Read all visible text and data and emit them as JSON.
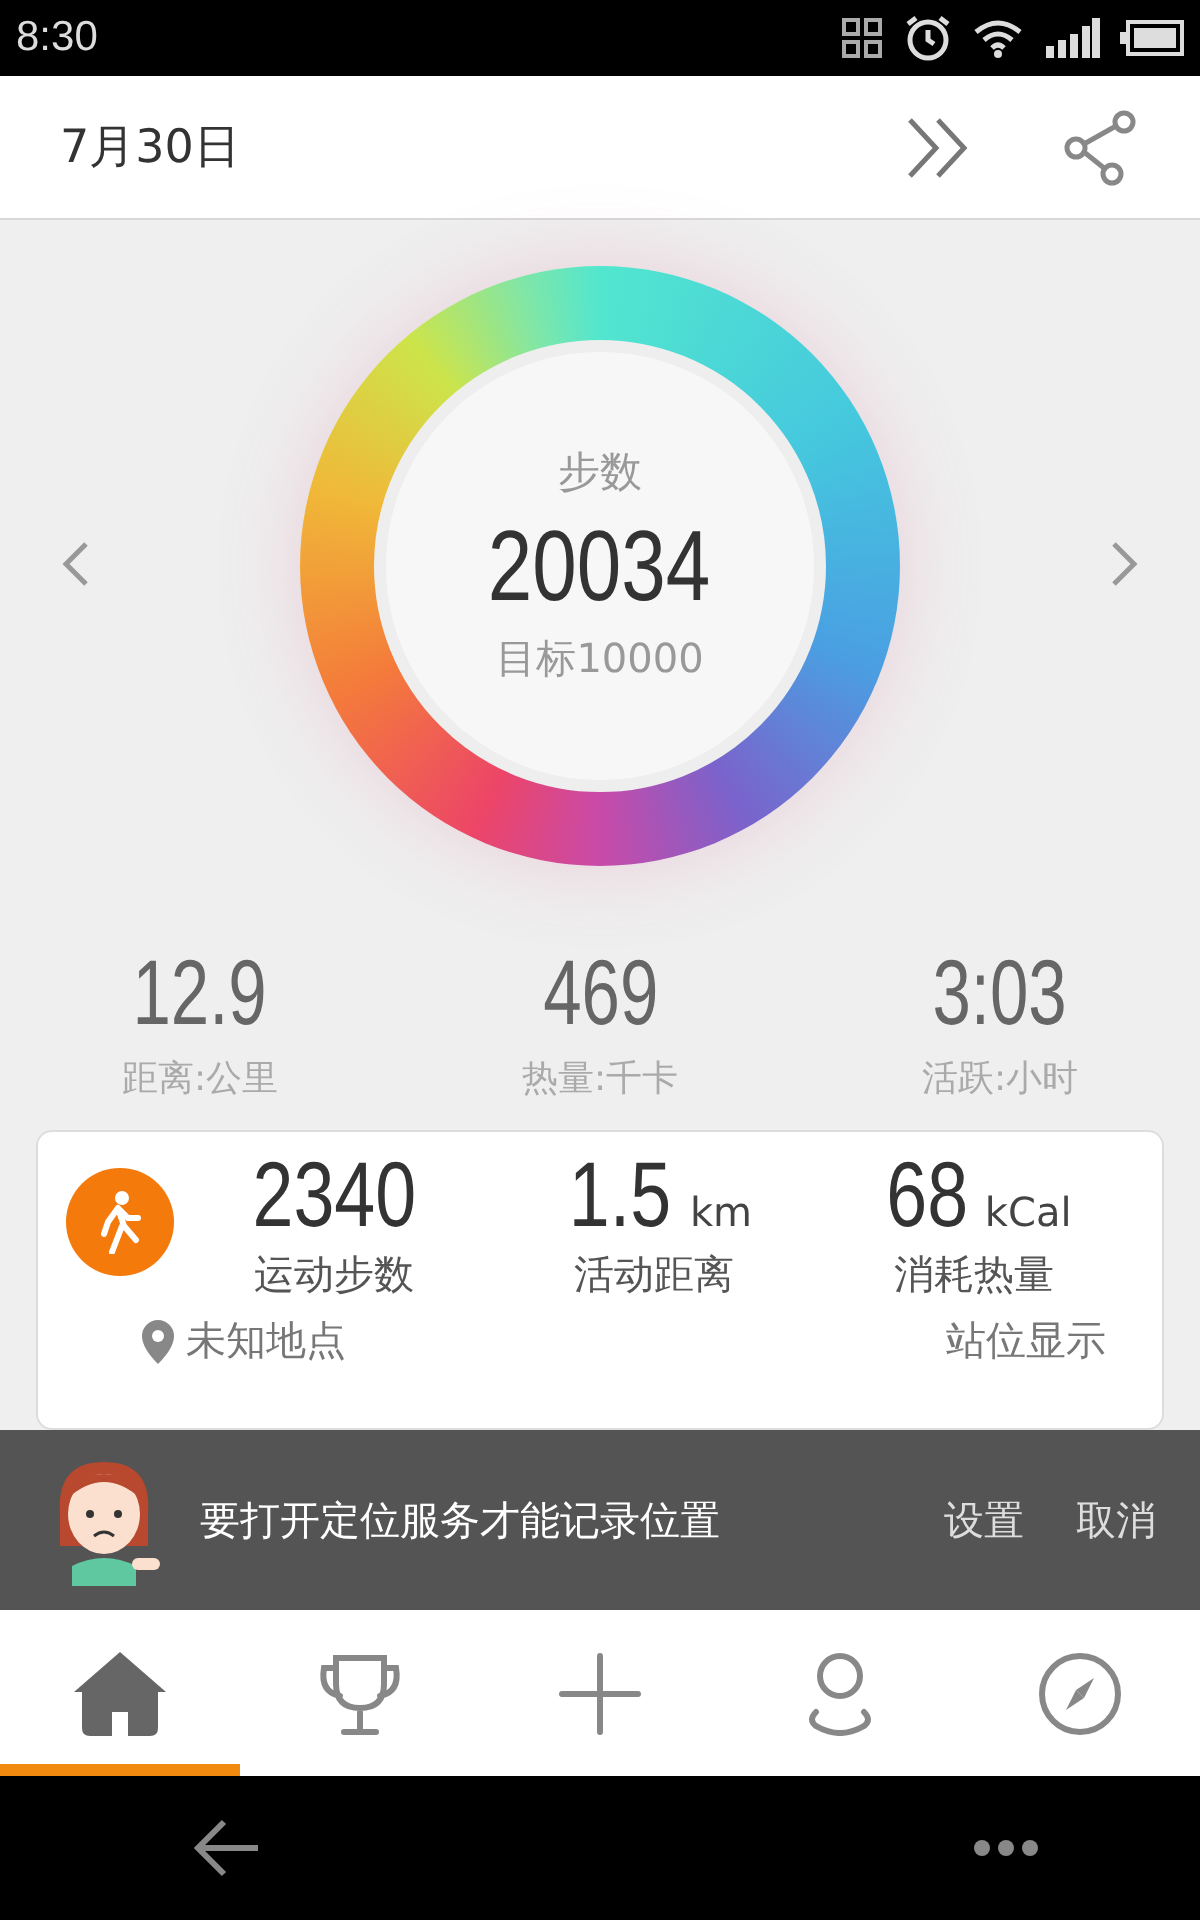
{
  "status_bar": {
    "time": "8:30"
  },
  "header": {
    "date": "7月30日"
  },
  "ring": {
    "label": "步数",
    "value": "20034",
    "goal": "目标10000"
  },
  "summary": [
    {
      "value": "12.9",
      "label": "距离:公里"
    },
    {
      "value": "469",
      "label": "热量:千卡"
    },
    {
      "value": "3:03",
      "label": "活跃:小时"
    }
  ],
  "activity_card": {
    "metrics": [
      {
        "value": "2340",
        "label": "运动步数"
      },
      {
        "value": "1.5",
        "unit": "km",
        "label": "活动距离"
      },
      {
        "value": "68",
        "unit": "kCal",
        "label": "消耗热量"
      }
    ],
    "location": "未知地点",
    "location_action": "站位显示"
  },
  "snackbar": {
    "message": "要打开定位服务才能记录位置",
    "actions": [
      "设置",
      "取消"
    ]
  },
  "tabs": [
    {
      "kind": "home",
      "selected": true
    },
    {
      "kind": "trophy",
      "selected": false
    },
    {
      "kind": "plus",
      "selected": false
    },
    {
      "kind": "profile",
      "selected": false
    },
    {
      "kind": "compass",
      "selected": false
    }
  ]
}
